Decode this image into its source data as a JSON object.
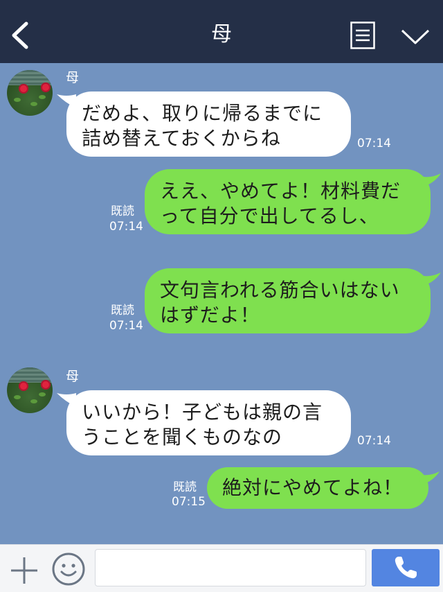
{
  "header": {
    "title": "母"
  },
  "messages": [
    {
      "sender": "母",
      "lines": [
        "だめよ、取りに帰るまでに",
        "詰め替えておくからね"
      ],
      "time": "07:14"
    },
    {
      "lines": [
        "ええ、やめてよ！材料費だ",
        "って自分で出してるし、"
      ],
      "read": "既読",
      "time": "07:14"
    },
    {
      "lines": [
        "文句言われる筋合いはない",
        "はずだよ！"
      ],
      "read": "既読",
      "time": "07:14"
    },
    {
      "sender": "母",
      "lines": [
        "いいから！子どもは親の言",
        "うことを聞くものなの"
      ],
      "time": "07:14"
    },
    {
      "lines": [
        "絶対にやめてよね！"
      ],
      "read": "既読",
      "time": "07:15"
    }
  ],
  "footer": {
    "input_value": ""
  },
  "colors": {
    "header_bg": "#242f47",
    "chat_bg": "#7293c0",
    "own_bubble": "#7fe04f",
    "other_bubble": "#ffffff",
    "call_button": "#5385e1"
  },
  "icons": {
    "back": "chevron-left-icon",
    "menu": "menu-list-icon",
    "collapse": "chevron-down-icon",
    "plus": "plus-icon",
    "sticker": "smile-icon",
    "call": "phone-icon"
  }
}
